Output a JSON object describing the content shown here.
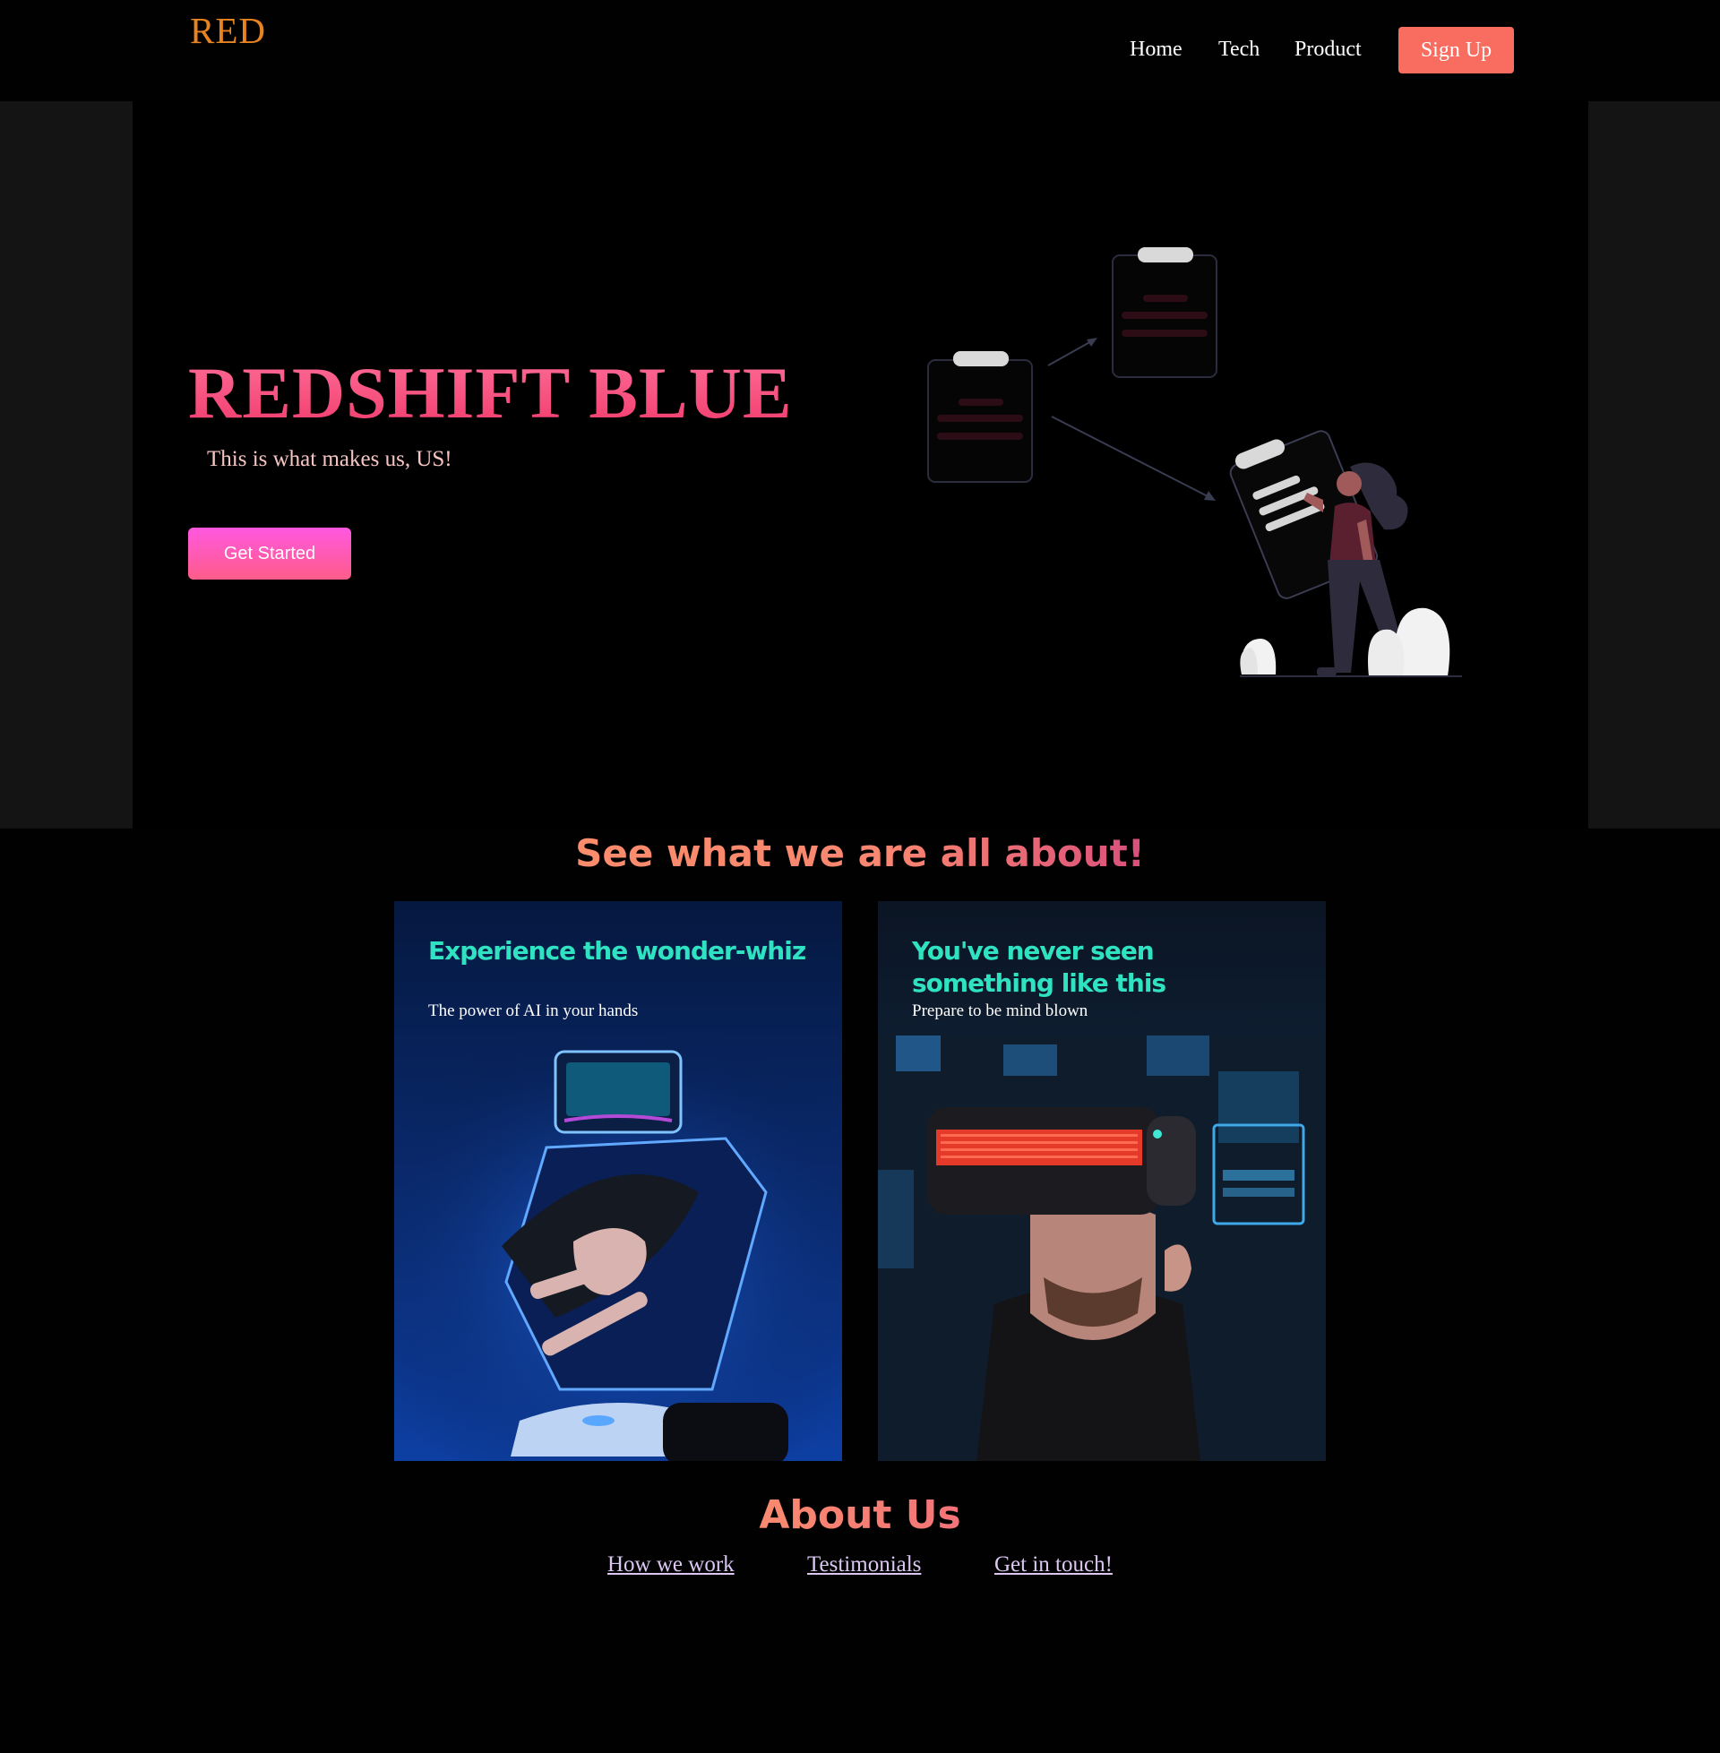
{
  "nav": {
    "logo": "RED",
    "links": [
      "Home",
      "Tech",
      "Product"
    ],
    "signup_label": "Sign Up"
  },
  "hero": {
    "title": "REDSHIFT BLUE",
    "subtitle": "This is what makes us, US!",
    "cta_label": "Get Started"
  },
  "features": {
    "heading": "See what we are all about!",
    "cards": [
      {
        "title": "Experience the wonder-whiz",
        "text": "The power of AI in your hands"
      },
      {
        "title": "You've never seen something like this",
        "text": "Prepare to be mind blown"
      }
    ]
  },
  "about": {
    "heading": "About Us",
    "links": [
      "How we work",
      "Testimonials",
      "Get in touch!"
    ]
  },
  "colors": {
    "logo": "#e8841f",
    "signup": "#f86d5f",
    "hero_title": "#f0396a",
    "card_title": "#2fe3c2",
    "about_link": "#dcc7f3"
  }
}
